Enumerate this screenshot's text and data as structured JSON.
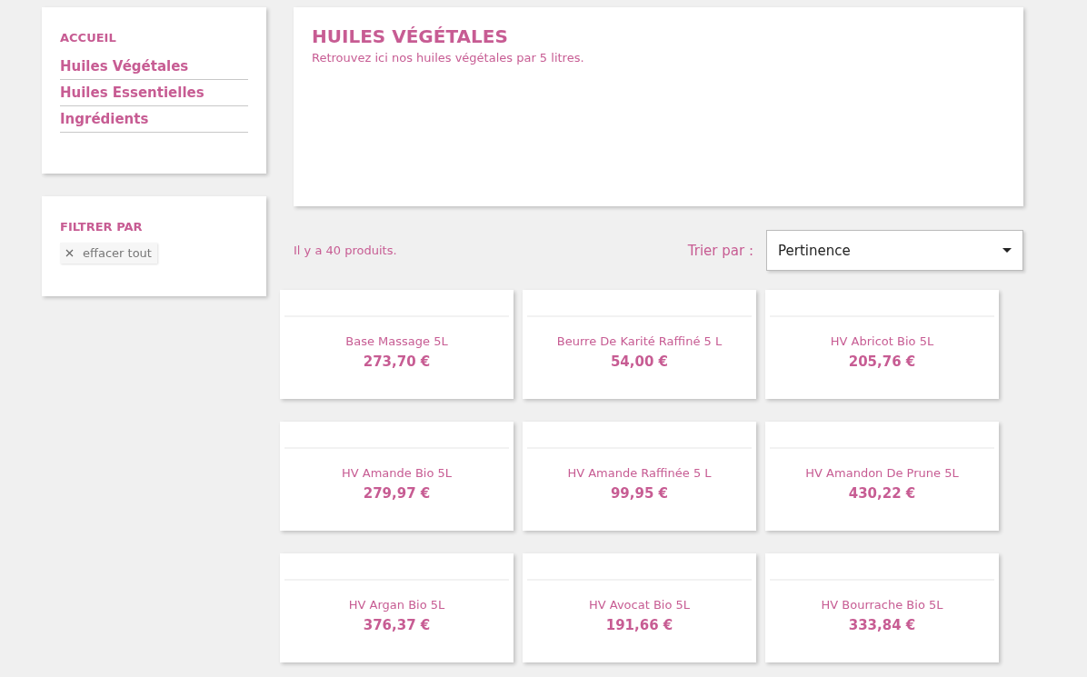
{
  "sidebar": {
    "title": "ACCUEIL",
    "items": [
      {
        "label": "Huiles Végétales"
      },
      {
        "label": "Huiles Essentielles"
      },
      {
        "label": "Ingrédients"
      }
    ]
  },
  "filter": {
    "title": "FILTRER PAR",
    "clear_label": "effacer tout"
  },
  "category": {
    "title": "HUILES VÉGÉTALES",
    "description": "Retrouvez ici nos huiles végétales par 5 litres."
  },
  "listing": {
    "count": "Il y a 40 produits.",
    "sort_label": "Trier par :",
    "sort_value": "Pertinence"
  },
  "products": [
    {
      "name": "Base Massage 5L",
      "price": "273,70 €"
    },
    {
      "name": "Beurre De Karité Raffiné 5 L",
      "price": "54,00 €"
    },
    {
      "name": "HV Abricot Bio 5L",
      "price": "205,76 €"
    },
    {
      "name": "HV Amande Bio 5L",
      "price": "279,97 €"
    },
    {
      "name": "HV Amande Raffinée 5 L",
      "price": "99,95 €"
    },
    {
      "name": "HV Amandon De Prune 5L",
      "price": "430,22 €"
    },
    {
      "name": "HV Argan Bio 5L",
      "price": "376,37 €"
    },
    {
      "name": "HV Avocat Bio 5L",
      "price": "191,66 €"
    },
    {
      "name": "HV Bourrache Bio 5L",
      "price": "333,84 €"
    }
  ]
}
